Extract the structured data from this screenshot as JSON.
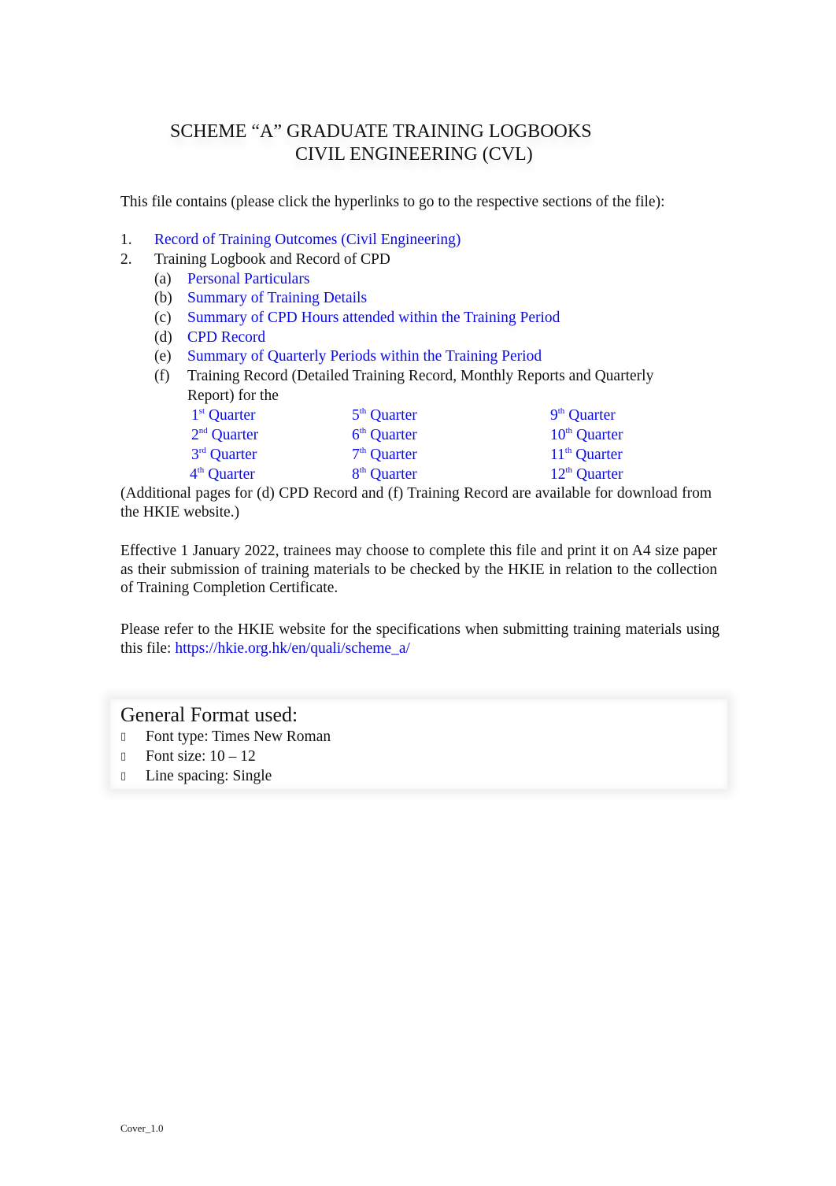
{
  "title": {
    "line1": "SCHEME “A” GRADUATE TRAINING LOGBOOKS",
    "line2": "CIVIL ENGINEERING (CVL)"
  },
  "intro": "This file contains (please click the hyperlinks to go to the respective sections of the file):",
  "items": [
    {
      "num": "1.",
      "label": "Record of Training Outcomes (Civil Engineering)",
      "link": true
    },
    {
      "num": "2.",
      "label": "Training Logbook and Record of CPD",
      "link": false
    }
  ],
  "subitems": [
    {
      "letter": "(a)",
      "label": "Personal Particulars",
      "link": true
    },
    {
      "letter": "(b)",
      "label": "Summary of Training Details",
      "link": true
    },
    {
      "letter": "(c)",
      "label": "Summary of CPD Hours attended within the Training Period",
      "link": true
    },
    {
      "letter": "(d)",
      "label": "CPD Record",
      "link": true
    },
    {
      "letter": "(e)",
      "label": "Summary of Quarterly Periods within the Training Period",
      "link": true
    },
    {
      "letter": "(f)",
      "label_line1": "Training Record (Detailed Training Record, Monthly Reports and Quarterly",
      "label_line2": "Report) for the",
      "link": false
    }
  ],
  "quarters": [
    {
      "n": "1",
      "sup": "st",
      "label": "Quarter"
    },
    {
      "n": "2",
      "sup": "nd",
      "label": "Quarter"
    },
    {
      "n": "3",
      "sup": "rd",
      "label": "Quarter"
    },
    {
      "n": "4",
      "sup": "th",
      "label": "Quarter"
    },
    {
      "n": "5",
      "sup": "th",
      "label": "Quarter"
    },
    {
      "n": "6",
      "sup": "th",
      "label": "Quarter"
    },
    {
      "n": "7",
      "sup": "th",
      "label": "Quarter"
    },
    {
      "n": "8",
      "sup": "th",
      "label": "Quarter"
    },
    {
      "n": "9",
      "sup": "th",
      "label": "Quarter"
    },
    {
      "n": "10",
      "sup": "th",
      "label": "Quarter"
    },
    {
      "n": "11",
      "sup": "th",
      "label": "Quarter"
    },
    {
      "n": "12",
      "sup": "th",
      "label": "Quarter"
    }
  ],
  "additional_note": "(Additional pages for (d) CPD Record and (f) Training Record are available for download from the HKIE website.)",
  "effective_note": "Effective 1 January 2022, trainees may choose to complete this file and print  it on A4 size paper as their submission of training materials to be checked by the HKIE in relation to the collection of Training Completion Certificate.",
  "refer_note": "Please refer to the HKIE website for the specifications when submitting training materials using this file: ",
  "refer_link": "https://hkie.org.hk/en/quali/scheme_a/",
  "general_format": {
    "title": "General Format used:",
    "bullet_icon": "▯",
    "items": [
      "Font type: Times New Roman",
      "Font size: 10 – 12",
      "Line spacing: Single"
    ]
  },
  "footer": "Cover_1.0",
  "colors": {
    "link": "#0a0ae6",
    "text": "#111111"
  }
}
